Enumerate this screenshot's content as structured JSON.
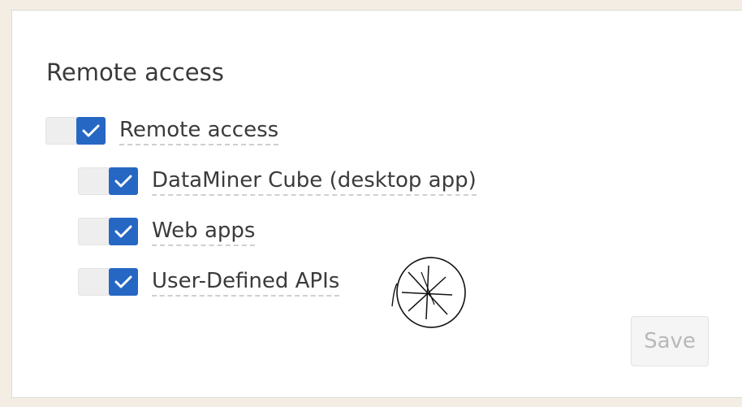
{
  "section": {
    "title": "Remote access"
  },
  "options": [
    {
      "id": "remote-access",
      "label": "Remote access",
      "checked": true,
      "level": 0
    },
    {
      "id": "dataminer-cube",
      "label": "DataMiner Cube (desktop app)",
      "checked": true,
      "level": 1
    },
    {
      "id": "web-apps",
      "label": "Web apps",
      "checked": true,
      "level": 1
    },
    {
      "id": "user-defined-apis",
      "label": "User-Defined APIs",
      "checked": true,
      "level": 1
    }
  ],
  "actions": {
    "save_label": "Save",
    "save_enabled": false
  },
  "colors": {
    "accent": "#2767c4",
    "page_background": "#f3ede4",
    "panel_background": "#ffffff",
    "disabled_text": "#b8b8b8"
  },
  "icons": {
    "check": "checkmark-icon",
    "sketch": "hand-drawn-asterisk-circle"
  }
}
